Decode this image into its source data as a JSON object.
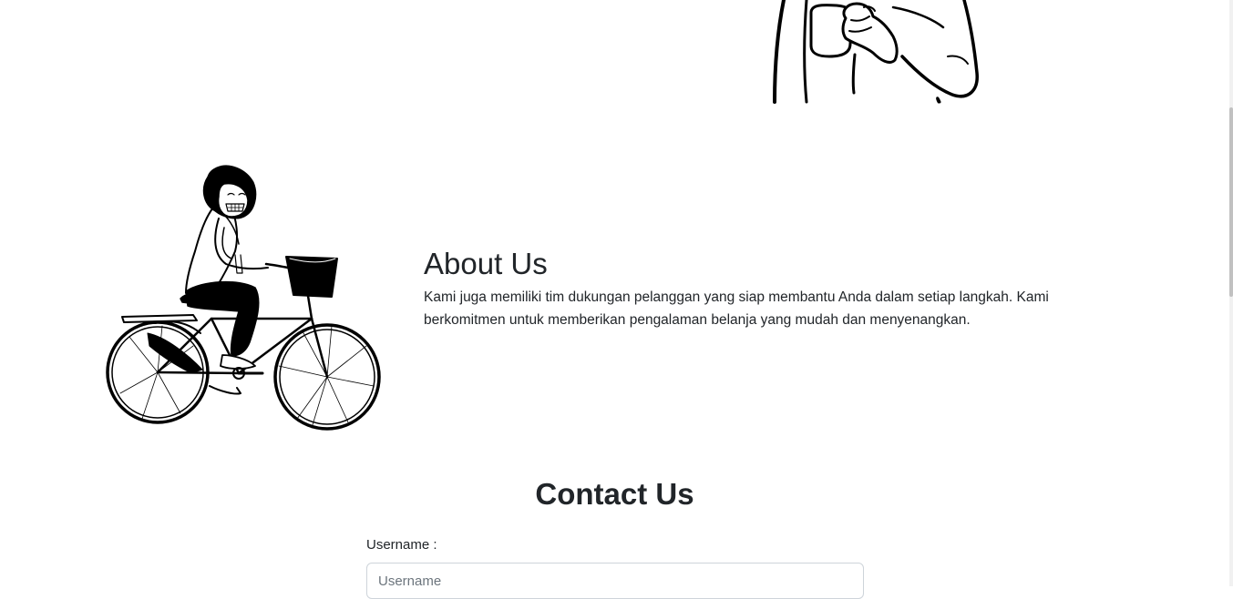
{
  "about": {
    "title": "About Us",
    "text": "Kami juga memiliki tim dukungan pelanggan yang siap membantu Anda dalam setiap langkah. Kami berkomitmen untuk memberikan pengalaman belanja yang mudah dan menyenangkan."
  },
  "contact": {
    "title": "Contact Us",
    "username_label": "Username :",
    "username_placeholder": "Username"
  },
  "icons": {
    "hero": "person-holding-mug-illustration",
    "about": "woman-riding-bicycle-illustration"
  },
  "colors": {
    "text": "#212529",
    "placeholder": "#6c757d",
    "input_border": "#ced4da"
  }
}
